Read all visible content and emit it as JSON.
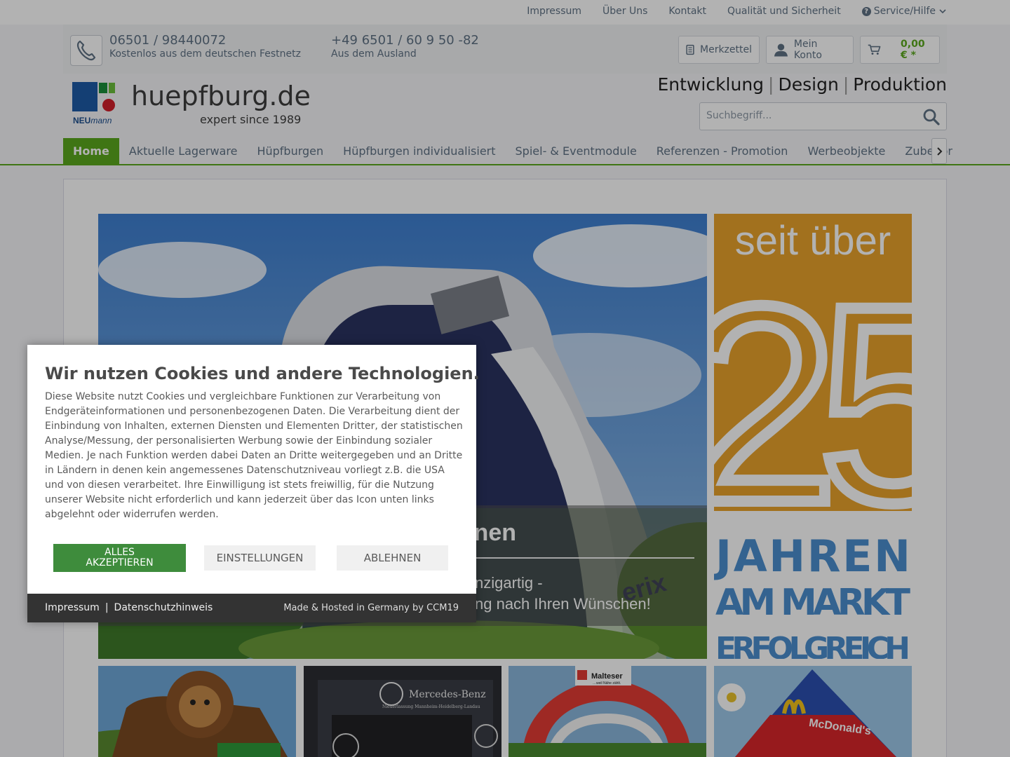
{
  "top_nav": [
    "Impressum",
    "Über Uns",
    "Kontakt",
    "Qualität und Sicherheit"
  ],
  "service_label": "Service/Hilfe",
  "contact": {
    "phone1": "06501 / 98440072",
    "phone1_sub": "Kostenlos aus dem deutschen Festnetz",
    "phone2": "+49 6501 / 60 9 50 -82",
    "phone2_sub": "Aus dem Ausland"
  },
  "account": {
    "wishlist": "Merkzettel",
    "my_account": "Mein Konto",
    "cart_price": "0,00 € *"
  },
  "logo": {
    "brand_name": "huepfburg.de",
    "brand_sub": "expert since 1989",
    "mark_text": "NEUmann"
  },
  "tagline": [
    "Entwicklung",
    "Design",
    "Produktion"
  ],
  "tagline_sep": "|",
  "search": {
    "placeholder": "Suchbegriff..."
  },
  "main_nav": [
    "Home",
    "Aktuelle Lagerware",
    "Hüpfburgen",
    "Hüpfburgen individualisiert",
    "Spiel- & Eventmodule",
    "Referenzen - Promotion",
    "Werbeobjekte",
    "Zubehör"
  ],
  "hero": {
    "title": "nen",
    "sub1": "nzigartig -",
    "sub2": "ng nach Ihren Wünschen!",
    "banner_text": "erix"
  },
  "side_banner": {
    "line1": "seit über",
    "number": "25",
    "line2": "JAHREN",
    "line3": "AM MARKT",
    "line4": "ERFOLGREICH"
  },
  "tiles": {
    "mercedes": "Mercedes-Benz",
    "mercedes_sub": "Niederlassung Mannheim-Heidelberg-Landau",
    "malteser": "Malteser",
    "malteser_sub": "…weil Nähe zählt.",
    "mcdonalds": "McDonald's"
  },
  "cookie": {
    "title": "Wir nutzen Cookies und andere Technologien.",
    "text": "Diese Website nutzt Cookies und vergleichbare Funktionen zur Verarbeitung von Endgeräteinformationen und personenbezogenen Daten. Die Verarbeitung dient der Einbindung von Inhalten, externen Diensten und Elementen Dritter, der statistischen Analyse/Messung, der personalisierten Werbung sowie der Einbindung sozialer Medien. Je nach Funktion werden dabei Daten an Dritte weitergegeben und an Dritte in Ländern in denen kein angemessenes Datenschutzniveau vorliegt z.B. die USA und von diesen verarbeitet. Ihre Einwilligung ist stets freiwillig, für die Nutzung unserer Website nicht erforderlich und kann jederzeit über das Icon unten links abgelehnt oder widerrufen werden.",
    "accept_line1": "ALLES",
    "accept_line2": "AKZEPTIEREN",
    "settings": "EINSTELLUNGEN",
    "decline": "ABLEHNEN",
    "footer_impressum": "Impressum",
    "footer_sep": "|",
    "footer_privacy": "Datenschutzhinweis",
    "footer_made": "Made & Hosted in Germany by CCM19"
  },
  "colors": {
    "accent_green": "#5ba81d",
    "cookie_accept": "#3e8c3c",
    "text_gray": "#5f7285",
    "banner_yellow": "#e9a32b",
    "banner_blue": "#4b8fcf"
  }
}
